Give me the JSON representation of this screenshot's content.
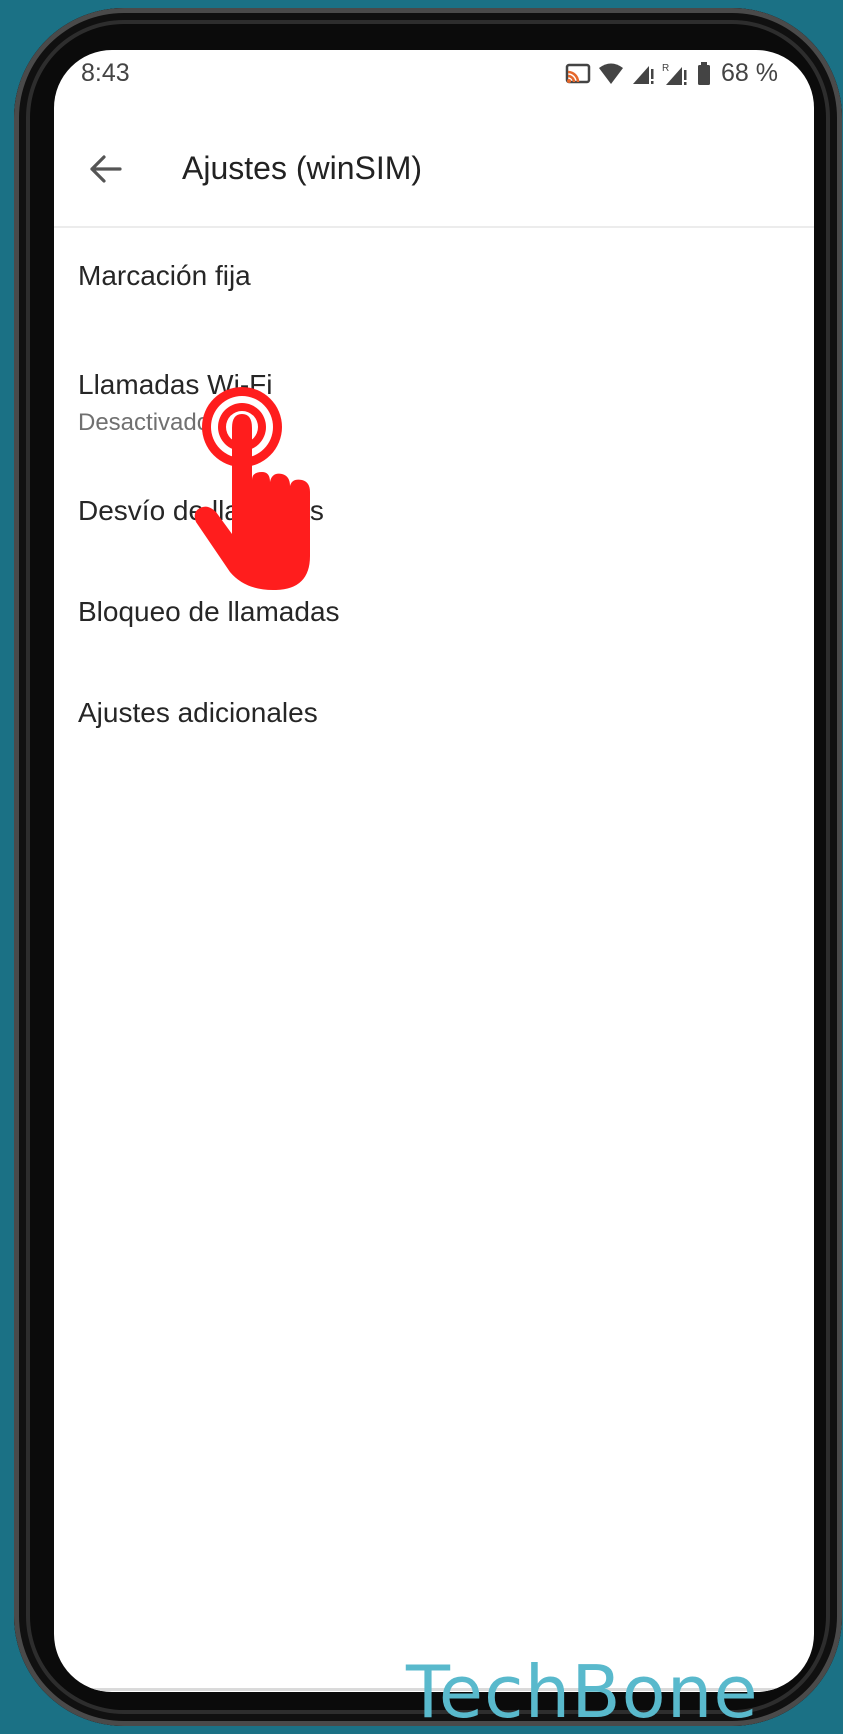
{
  "status_bar": {
    "time": "8:43",
    "battery": "68 %",
    "icons": [
      "cast-icon",
      "wifi-icon",
      "signal-icon",
      "roaming-signal-icon",
      "battery-icon"
    ]
  },
  "app_bar": {
    "back_icon": "arrow-left-icon",
    "title": "Ajustes (winSIM)"
  },
  "settings_list": {
    "items": [
      {
        "title": "Marcación fija"
      },
      {
        "title": "Llamadas Wi-Fi",
        "summary": "Desactivado"
      },
      {
        "title": "Desvío de llamadas"
      },
      {
        "title": "Bloqueo de llamadas"
      },
      {
        "title": "Ajustes adicionales"
      }
    ]
  },
  "overlay": {
    "icon": "tap-hand-icon",
    "color": "#ff1d1d"
  },
  "watermark": "TechBone",
  "colors": {
    "background": "#1b7185",
    "watermark": "#59b9cc"
  }
}
